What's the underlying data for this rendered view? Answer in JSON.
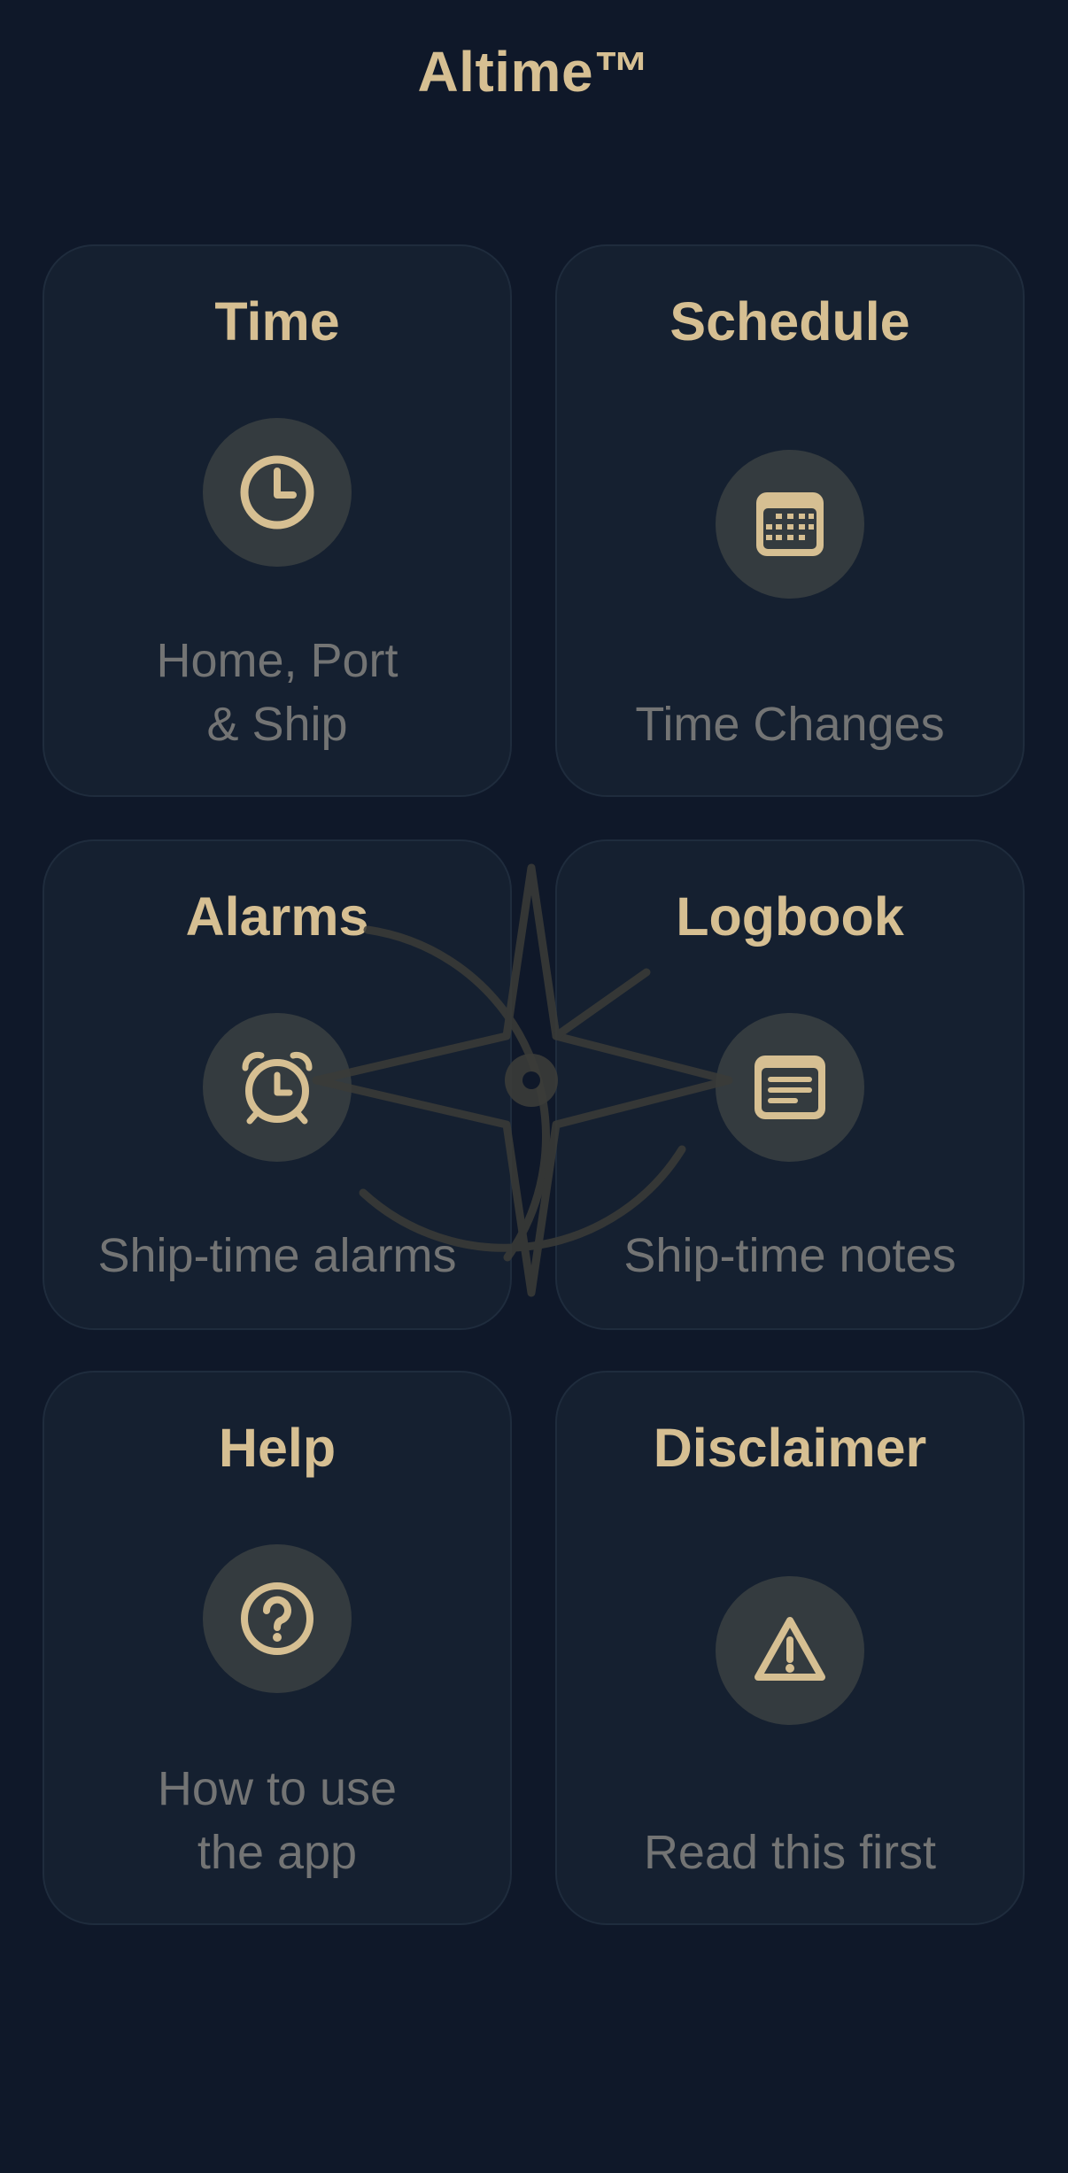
{
  "app": {
    "title": "Altime™"
  },
  "colors": {
    "background": "#0f1829",
    "card": "#152030",
    "card_border": "#1f2c3d",
    "accent_gold": "#d6bf92",
    "icon_circle": "#343b3f",
    "subtitle": "#737474"
  },
  "cards": [
    {
      "title": "Time",
      "subtitle": "Home, Port\n& Ship",
      "icon": "clock-icon"
    },
    {
      "title": "Schedule",
      "subtitle": "Time Changes",
      "icon": "calendar-icon"
    },
    {
      "title": "Alarms",
      "subtitle": "Ship-time alarms",
      "icon": "alarm-clock-icon"
    },
    {
      "title": "Logbook",
      "subtitle": "Ship-time notes",
      "icon": "notes-icon"
    },
    {
      "title": "Help",
      "subtitle": "How to use\nthe app",
      "icon": "question-icon"
    },
    {
      "title": "Disclaimer",
      "subtitle": "Read this first",
      "icon": "warning-icon"
    }
  ],
  "background_decoration": "compass-rose-icon"
}
